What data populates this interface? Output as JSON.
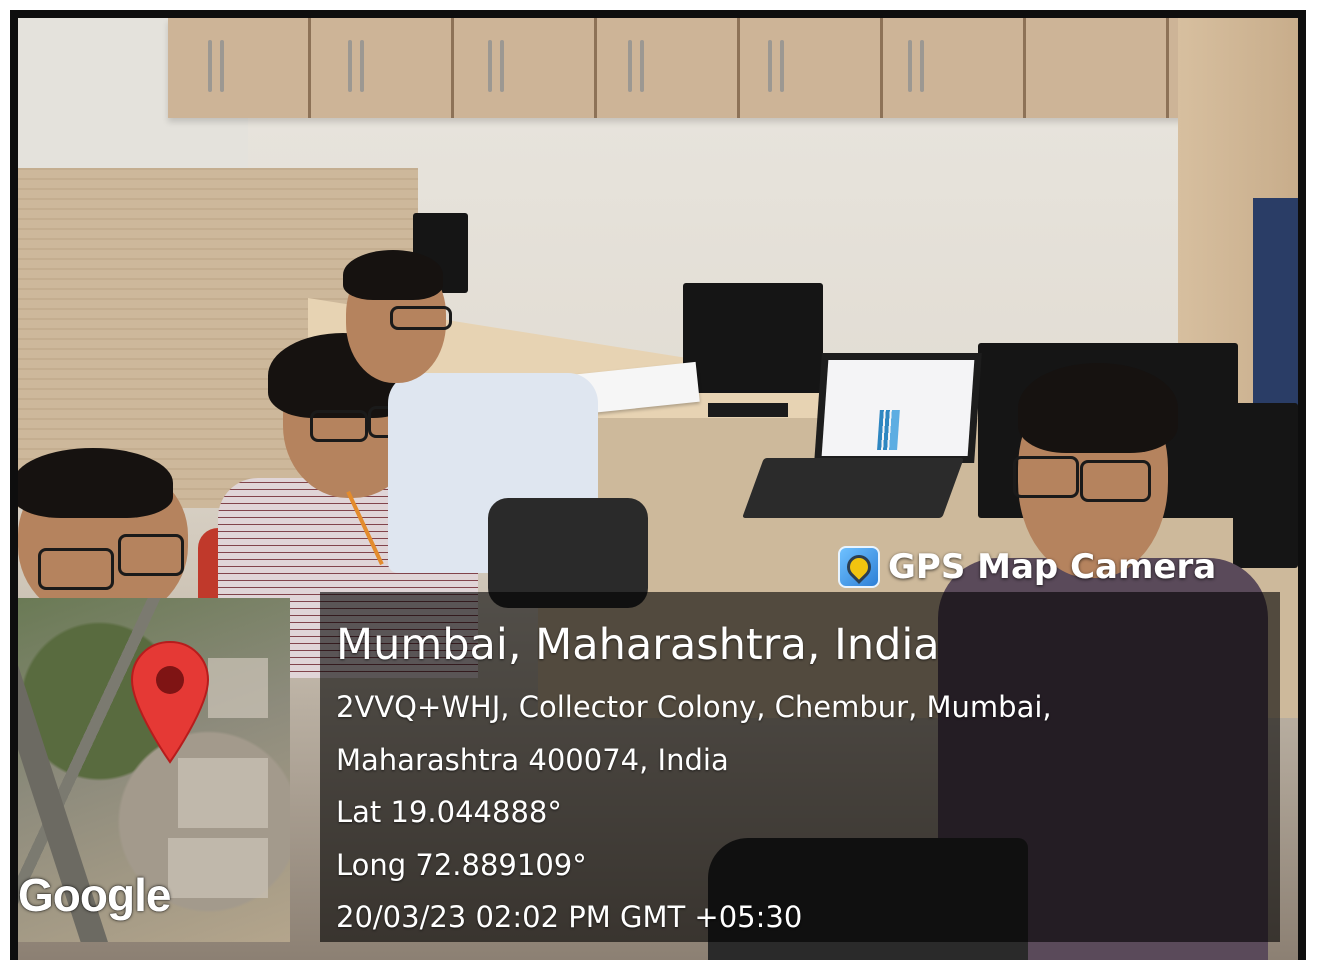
{
  "overlay": {
    "app_name": "GPS Map Camera",
    "location_title": "Mumbai, Maharashtra, India",
    "address_line_1": "2VVQ+WHJ, Collector Colony, Chembur, Mumbai,",
    "address_line_2": "Maharashtra 400074, India",
    "latitude": "Lat 19.044888°",
    "longitude": "Long 72.889109°",
    "timestamp": "20/03/23 02:02 PM GMT +05:30"
  },
  "map": {
    "attribution": "Google",
    "pin_color": "#e53935"
  },
  "colors": {
    "panel_background": "rgba(0,0,0,0.6)",
    "overlay_text": "#ffffff"
  }
}
